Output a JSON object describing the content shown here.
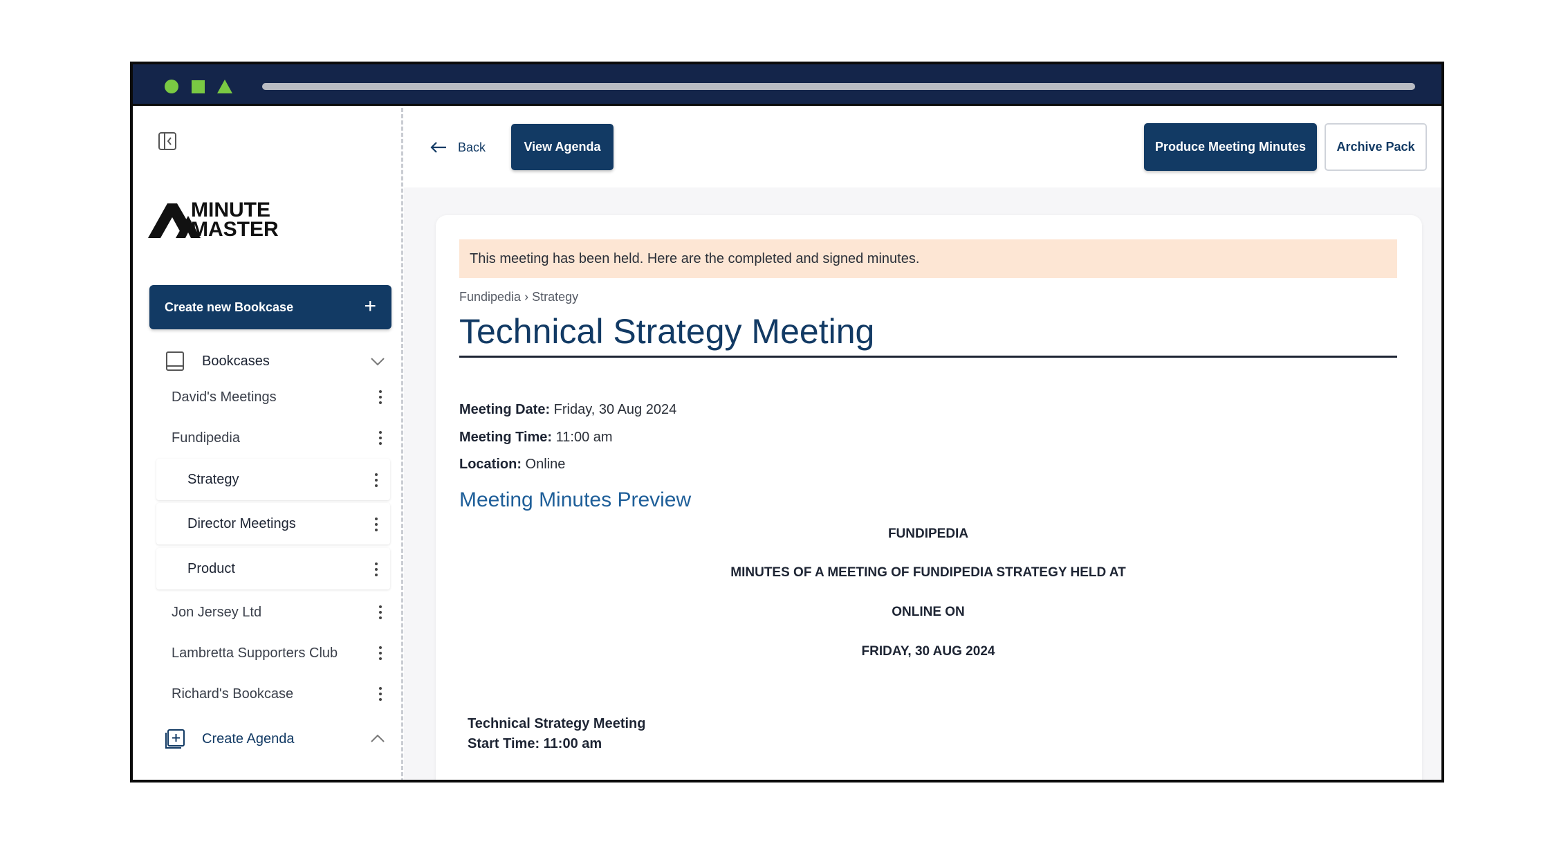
{
  "brand": {
    "line1": "MINUTE",
    "line2": "MASTER"
  },
  "sidebar": {
    "create_button": "Create new Bookcase",
    "bookcases_label": "Bookcases",
    "items": [
      {
        "label": "David's Meetings"
      },
      {
        "label": "Fundipedia"
      },
      {
        "label": "Jon Jersey Ltd"
      },
      {
        "label": "Lambretta Supporters Club"
      },
      {
        "label": "Richard's Bookcase"
      }
    ],
    "subitems": [
      {
        "label": "Strategy"
      },
      {
        "label": "Director Meetings"
      },
      {
        "label": "Product"
      }
    ],
    "create_agenda_label": "Create Agenda"
  },
  "toolbar": {
    "back_label": "Back",
    "view_agenda_label": "View Agenda",
    "produce_label": "Produce Meeting Minutes",
    "archive_label": "Archive Pack"
  },
  "meeting": {
    "alert": "This meeting has been held. Here are the completed and signed minutes.",
    "breadcrumb": "Fundipedia › Strategy",
    "title": "Technical Strategy Meeting",
    "date_label": "Meeting Date:",
    "date_value": " Friday, 30 Aug 2024",
    "time_label": "Meeting Time:",
    "time_value": " 11:00 am",
    "location_label": "Location:",
    "location_value": " Online",
    "preview_title": "Meeting Minutes Preview"
  },
  "minutes": {
    "org": "FUNDIPEDIA",
    "heading": "MINUTES OF A MEETING OF FUNDIPEDIA STRATEGY HELD AT",
    "place": "ONLINE ON",
    "date": "FRIDAY, 30 AUG 2024",
    "meeting_name": "Technical Strategy Meeting",
    "start_time": "Start Time: 11:00 am"
  },
  "colors": {
    "navy": "#123a64",
    "titlebar": "#14254a",
    "accent_green": "#7ac943",
    "alert_bg": "#fde6d4"
  }
}
